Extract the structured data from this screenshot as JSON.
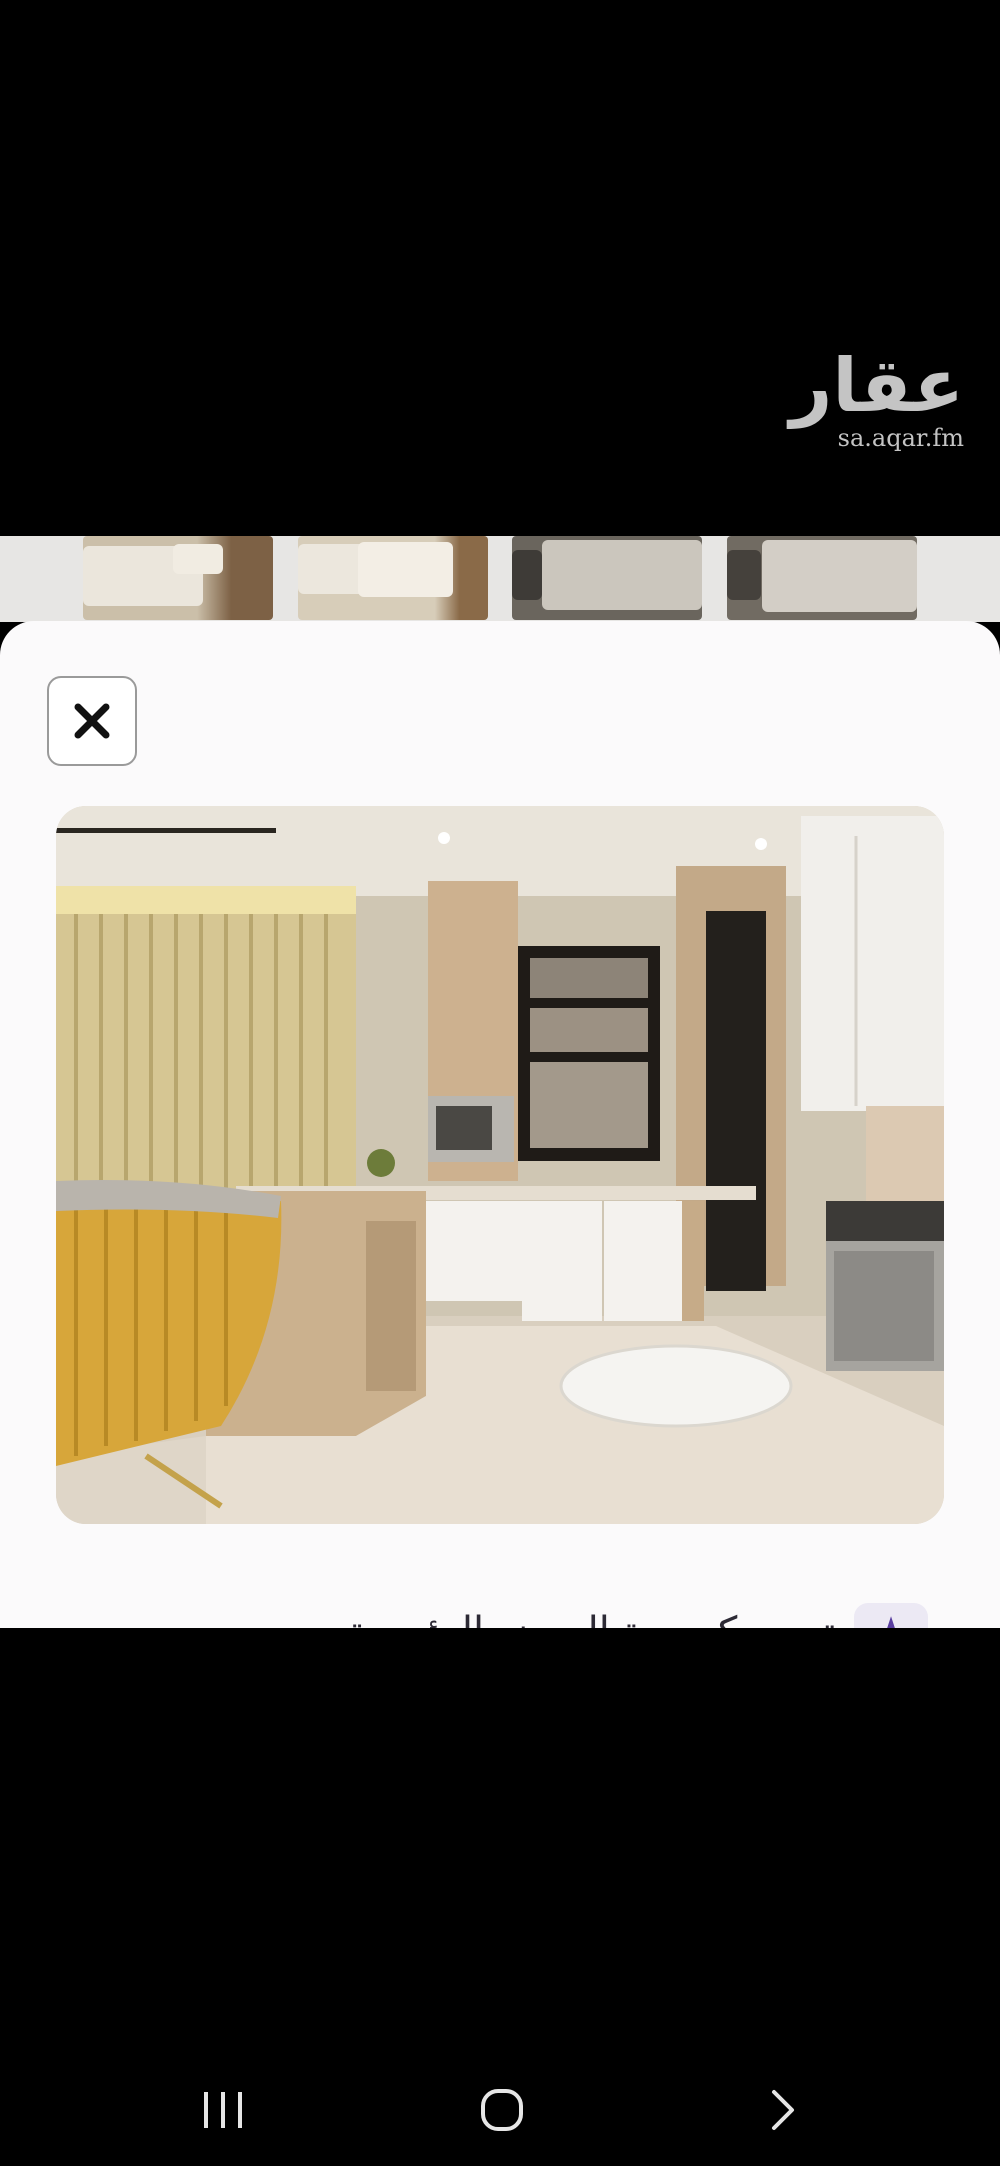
{
  "watermark": {
    "logo": "عقار",
    "url": "sa.aqar.fm"
  },
  "thumbnails": [
    {
      "name": "bedroom-1",
      "wall": "#8b7355",
      "bed": "#e8e2d6"
    },
    {
      "name": "bedroom-2",
      "wall": "#a08866",
      "bed": "#ebe5da"
    },
    {
      "name": "bedroom-3",
      "wall": "#55524d",
      "bed": "#cfcac2"
    },
    {
      "name": "bedroom-4",
      "wall": "#5d5a55",
      "bed": "#d8d3cb"
    }
  ],
  "sheet": {
    "close_icon": "close-icon",
    "caption": "تعيين كصورة العرض الرئيسية",
    "star_icon": "star-icon",
    "star_glyph": "★"
  },
  "colors": {
    "accent": "#5a3ea0",
    "sheet_bg": "#fbfafb"
  },
  "nav": {
    "recents_icon": "recents-icon",
    "home_icon": "home-icon",
    "back_icon": "back-icon"
  }
}
